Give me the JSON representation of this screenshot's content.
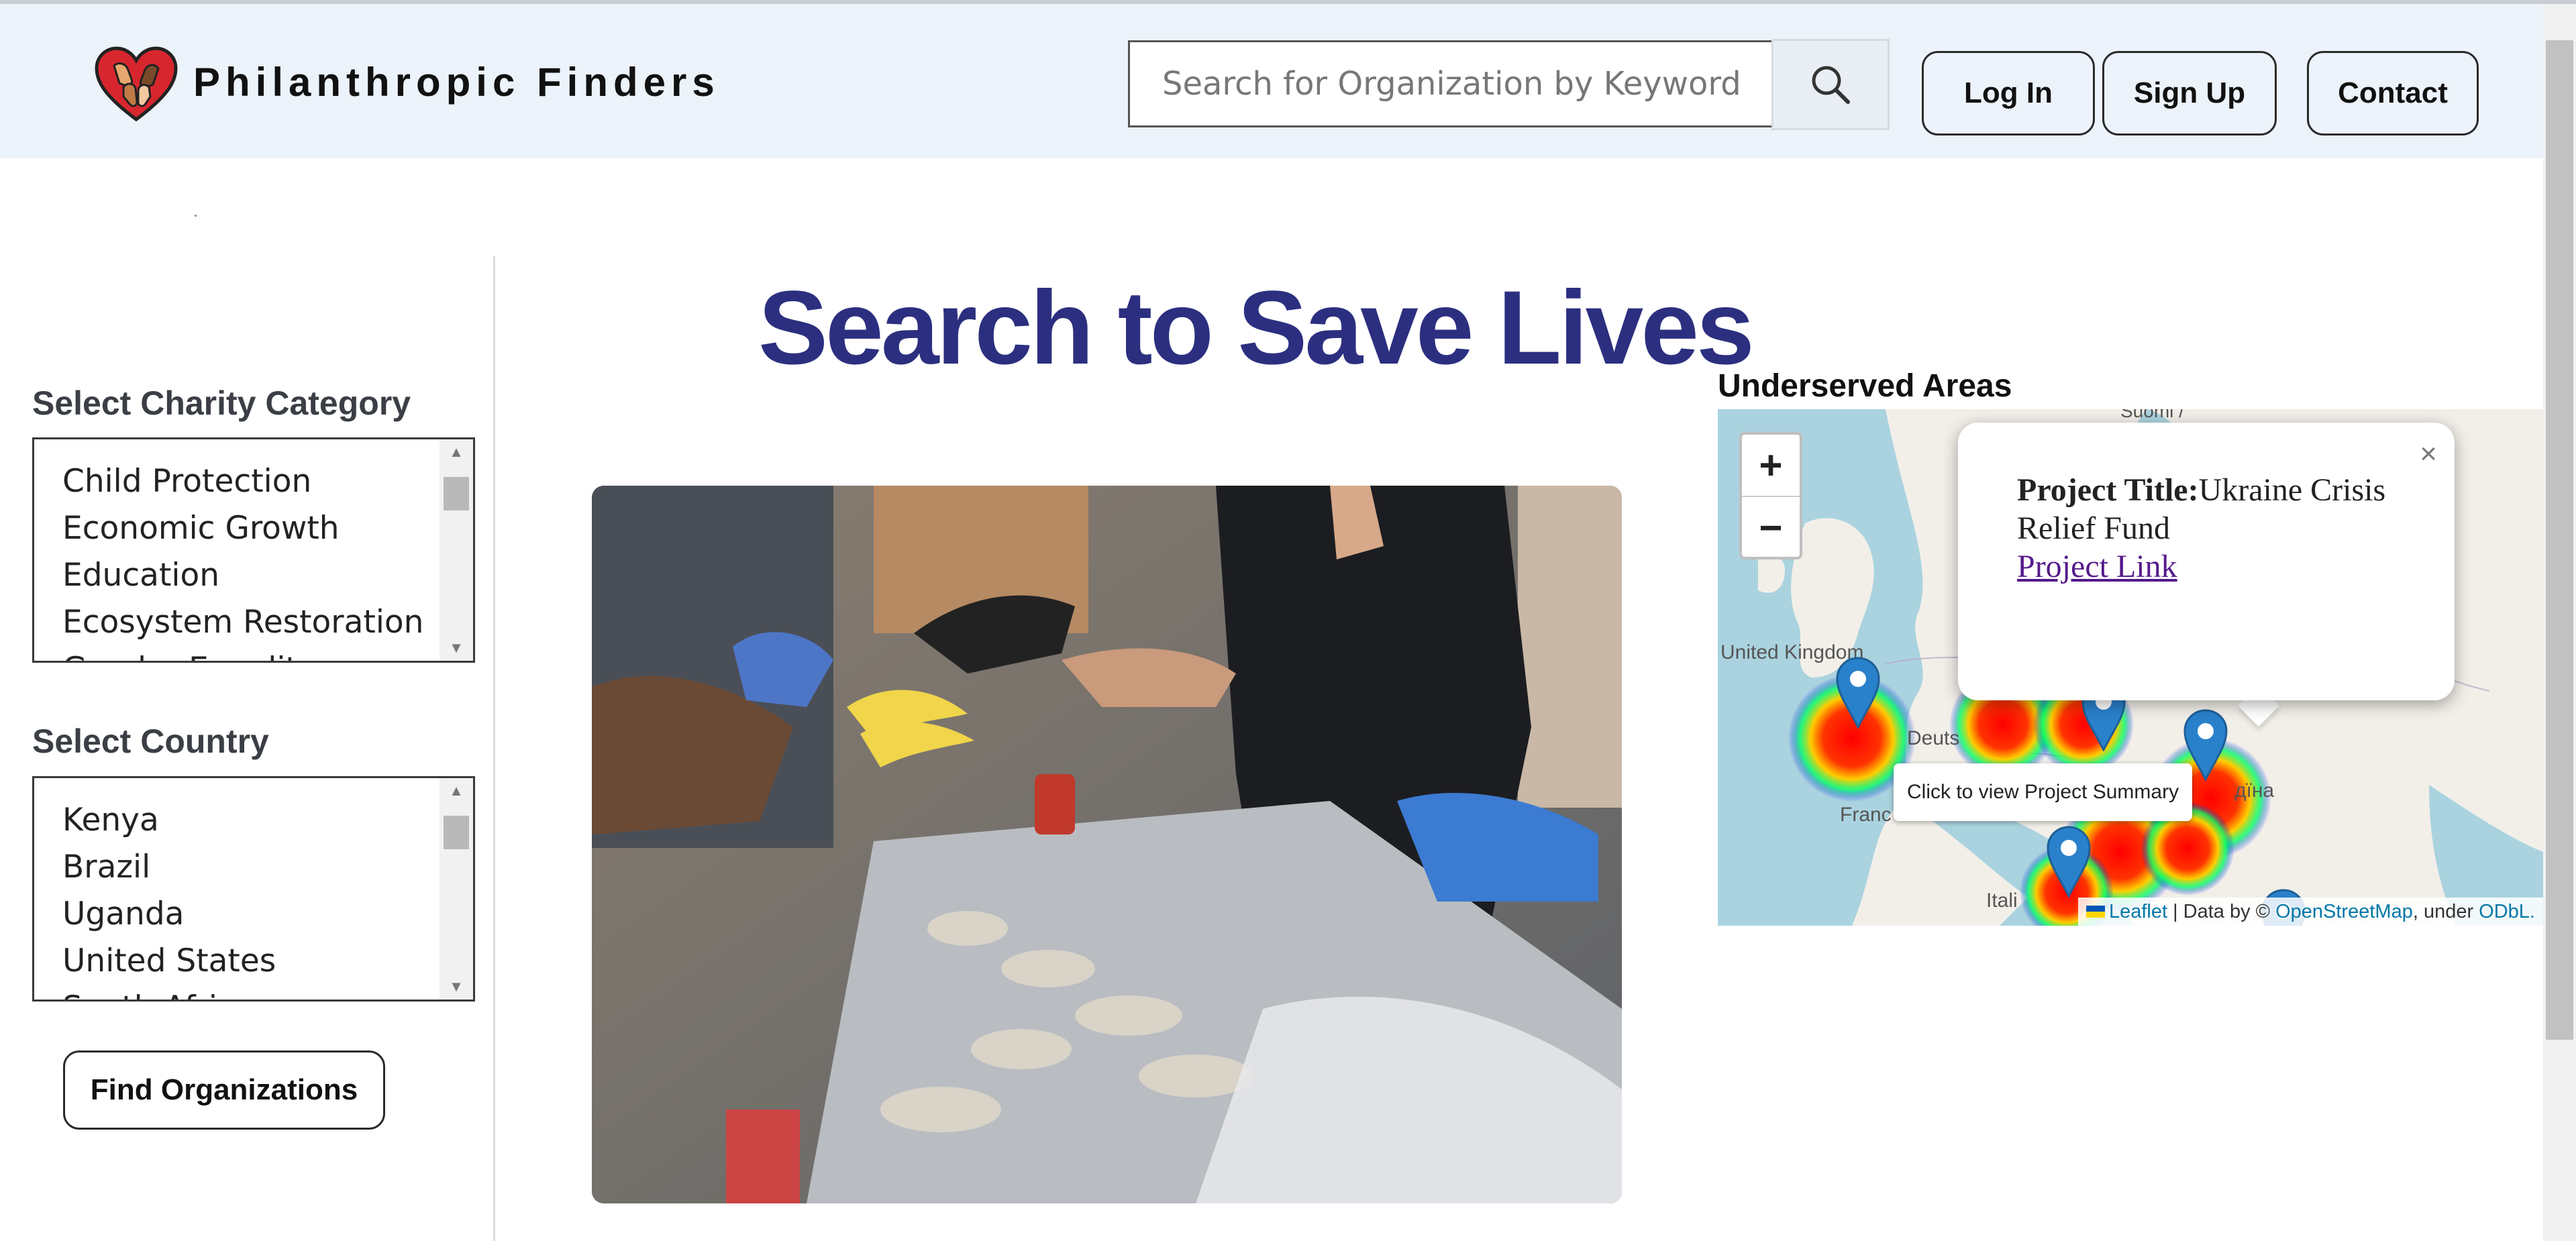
{
  "header": {
    "brand": "Philanthropic Finders",
    "search_placeholder": "Search for Organization by Keyword",
    "buttons": {
      "login": "Log In",
      "signup": "Sign Up",
      "contact": "Contact"
    }
  },
  "sidebar": {
    "category_label": "Select Charity Category",
    "categories": [
      "Child Protection",
      "Economic Growth",
      "Education",
      "Ecosystem Restoration",
      "Gender Equality"
    ],
    "country_label": "Select Country",
    "countries": [
      "Kenya",
      "Brazil",
      "Uganda",
      "United States",
      "South Africa"
    ],
    "find_button": "Find Organizations"
  },
  "main": {
    "title": "Search to Save Lives"
  },
  "map": {
    "label": "Underserved Areas",
    "zoom_in": "+",
    "zoom_out": "−",
    "popup": {
      "title_label": "Project Title:",
      "title_value": "Ukraine Crisis Relief Fund",
      "link_text": "Project Link",
      "close": "×"
    },
    "tooltip": "Click to view Project Summary",
    "place_labels": [
      "United Kingdom",
      "Deuts",
      "Franc",
      "Itali",
      "Suomi /",
      "дїна"
    ],
    "attribution": {
      "leaflet": "Leaflet",
      "middle": " | Data by © ",
      "osm": "OpenStreetMap",
      "under": ", under ",
      "odbl": "ODbL."
    }
  },
  "colors": {
    "header_bg": "#edf3fb",
    "title": "#2c2f7f",
    "marker": "#2a81cb",
    "water": "#aad3df",
    "land": "#f2efe9"
  },
  "icons": {
    "logo": "heart-hands-icon",
    "search": "search-icon",
    "marker": "map-marker-icon"
  }
}
